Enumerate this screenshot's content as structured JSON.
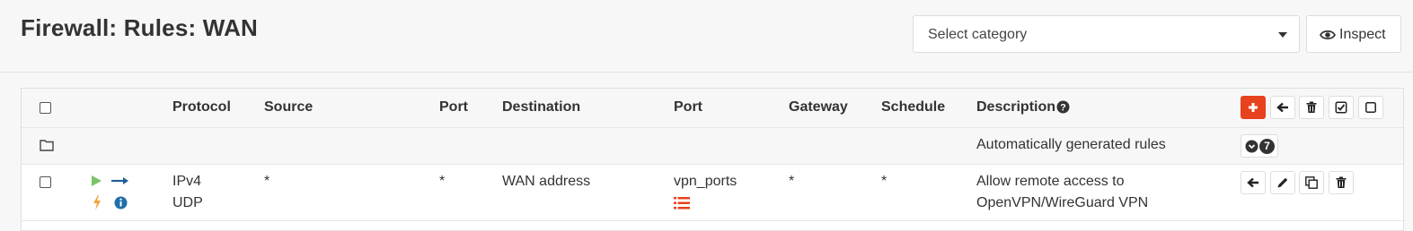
{
  "header": {
    "title": "Firewall: Rules: WAN",
    "category_select": {
      "placeholder": "Select category"
    },
    "inspect_label": "Inspect"
  },
  "table": {
    "columns": {
      "protocol": "Protocol",
      "source": "Source",
      "port": "Port",
      "destination": "Destination",
      "dest_port": "Port",
      "gateway": "Gateway",
      "schedule": "Schedule",
      "description": "Description"
    },
    "auto_row": {
      "description": "Automatically generated rules",
      "count": "7"
    },
    "rules": [
      {
        "protocol_line1": "IPv4",
        "protocol_line2": "UDP",
        "source": "*",
        "port": "*",
        "destination": "WAN address",
        "dest_port": "vpn_ports",
        "gateway": "*",
        "schedule": "*",
        "description_line1": "Allow remote access to",
        "description_line2": "OpenVPN/WireGuard VPN"
      }
    ]
  },
  "colors": {
    "accent_orange": "#e8411e",
    "pass_green": "#7ac36a",
    "direction_blue": "#1f5e99",
    "quick_orange": "#f0a33a",
    "info_blue": "#1f6fa8",
    "alias_red": "#e8411e"
  },
  "icons": {
    "inspect": "eye-icon",
    "add": "plus-icon",
    "move": "arrow-left-icon",
    "delete": "trash-icon",
    "enable": "check-square-icon",
    "disable": "square-icon",
    "auto_group": "folder-icon",
    "expand": "chevron-circle-down-icon",
    "pass": "play-icon",
    "direction": "arrow-right-icon",
    "quick": "bolt-icon",
    "info": "info-circle-icon",
    "alias": "list-icon",
    "edit": "pencil-icon",
    "clone": "clone-icon"
  }
}
